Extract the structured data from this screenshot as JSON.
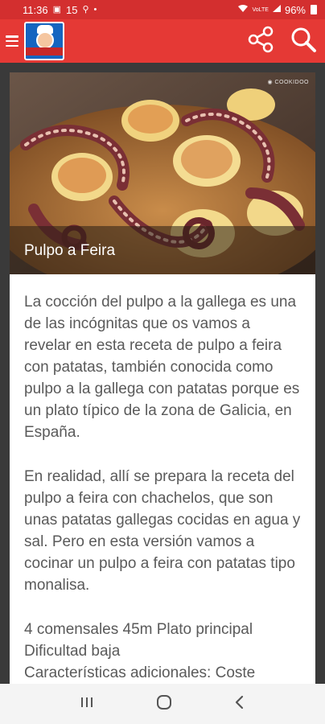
{
  "status_bar": {
    "time": "11:36",
    "notif_count": "15",
    "battery": "96%"
  },
  "app_bar": {
    "menu_icon": "hamburger-menu-icon",
    "logo_icon": "chef-logo-icon",
    "share_icon": "share-icon",
    "search_icon": "search-icon"
  },
  "recipe": {
    "title": "Pulpo a Feira",
    "paragraph1": "La cocción del pulpo a la gallega es una de las incógnitas que os vamos a revelar en esta receta de pulpo a feira con patatas, también conocida como pulpo a la gallega con patatas porque es un plato típico de la zona de Galicia, en España.",
    "paragraph2": "En realidad, allí se prepara la receta del pulpo a feira con chachelos, que son unas patatas gallegas cocidas en agua y sal. Pero en esta versión vamos a cocinar un pulpo a feira con patatas tipo monalisa.",
    "meta_line1": "4 comensales 45m Plato principal",
    "meta_line2": "Dificultad baja",
    "meta_line3": "Características adicionales: Coste"
  },
  "nav_bar": {
    "recents_icon": "recents-icon",
    "home_icon": "home-icon",
    "back_icon": "back-icon"
  },
  "colors": {
    "primary": "#e53935",
    "status": "#d32f2f",
    "background": "#3a3a3a",
    "text": "#5a5a5a"
  }
}
